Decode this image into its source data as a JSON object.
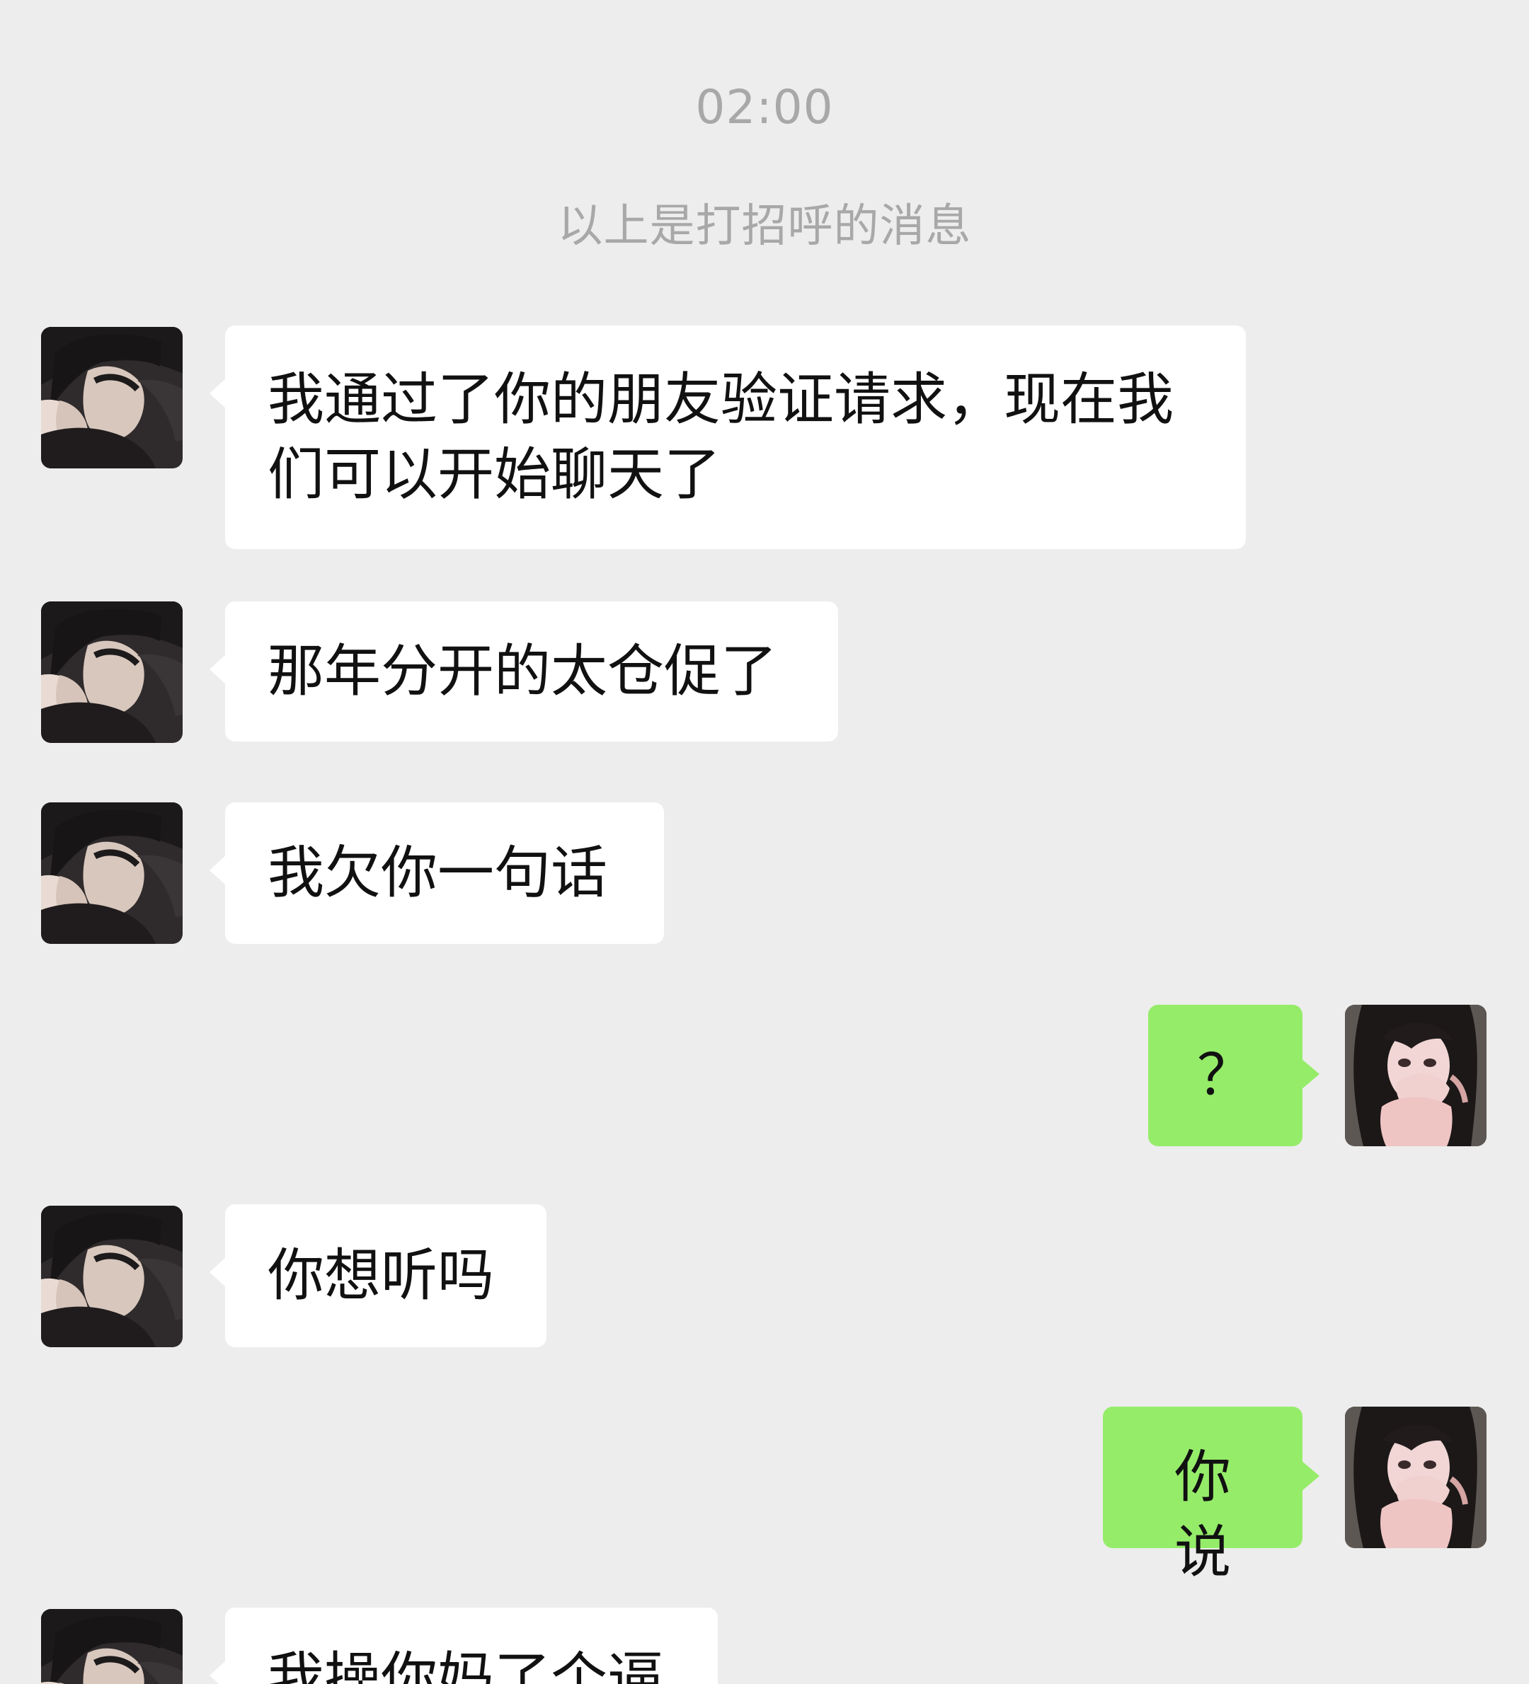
{
  "chat": {
    "timestamp": "02:00",
    "system_notice": "以上是打招呼的消息",
    "messages": [
      {
        "sender": "contact",
        "text": "我通过了你的朋友验证请求，现在我们可以开始聊天了"
      },
      {
        "sender": "contact",
        "text": "那年分开的太仓促了"
      },
      {
        "sender": "contact",
        "text": "我欠你一句话"
      },
      {
        "sender": "me",
        "text": "？"
      },
      {
        "sender": "contact",
        "text": "你想听吗"
      },
      {
        "sender": "me",
        "text": "你说"
      },
      {
        "sender": "contact",
        "text": "我操你妈了个逼"
      }
    ]
  },
  "theme": {
    "background": "#ededed",
    "incoming_bubble": "#ffffff",
    "outgoing_bubble": "#95ec69",
    "system_text": "#a8a8a8",
    "message_text": "#111111"
  },
  "icons": {
    "contact_avatar": "contact-avatar-icon",
    "self_avatar": "self-avatar-icon"
  }
}
